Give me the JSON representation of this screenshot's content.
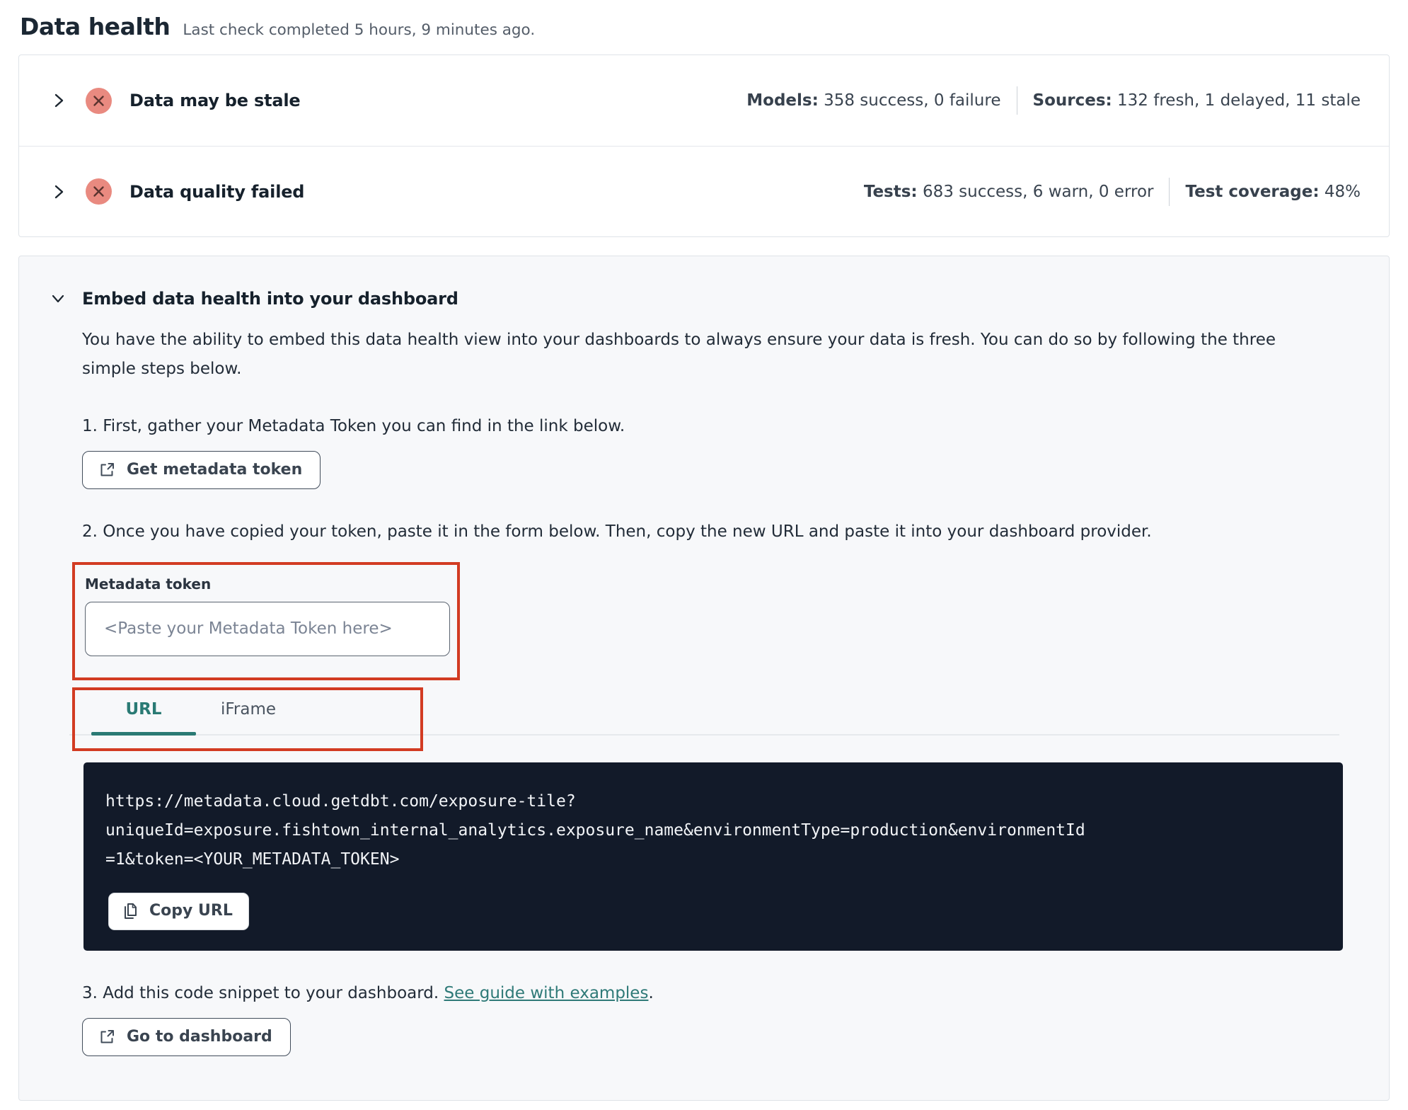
{
  "page": {
    "title": "Data health",
    "subtitle": "Last check completed 5 hours, 9 minutes ago."
  },
  "status_rows": [
    {
      "title": "Data may be stale",
      "status_icon": "error-x-circle",
      "stats": [
        {
          "label": "Models:",
          "value": "358 success, 0 failure"
        },
        {
          "label": "Sources:",
          "value": "132 fresh, 1 delayed, 11 stale"
        }
      ]
    },
    {
      "title": "Data quality failed",
      "status_icon": "error-x-circle",
      "stats": [
        {
          "label": "Tests:",
          "value": "683 success, 6 warn, 0 error"
        },
        {
          "label": "Test coverage:",
          "value": "48%"
        }
      ]
    }
  ],
  "embed": {
    "title": "Embed data health into your dashboard",
    "description": "You have the ability to embed this data health view into your dashboards to always ensure your data is fresh. You can do so by following the three simple steps below.",
    "step1": "1. First, gather your Metadata Token you can find in the link below.",
    "get_token_button": "Get metadata token",
    "step2": "2. Once you have copied your token, paste it in the form below. Then, copy the new URL and paste it into your dashboard provider.",
    "token_field": {
      "label": "Metadata token",
      "placeholder": "<Paste your Metadata Token here>"
    },
    "tabs": [
      {
        "label": "URL",
        "active": true
      },
      {
        "label": "iFrame",
        "active": false
      }
    ],
    "code_lines": [
      "https://metadata.cloud.getdbt.com/exposure-tile?",
      "uniqueId=exposure.fishtown_internal_analytics.exposure_name&environmentType=production&environmentId",
      "=1&token=<YOUR_METADATA_TOKEN>"
    ],
    "copy_button": "Copy URL",
    "step3_prefix": "3. Add this code snippet to your dashboard. ",
    "step3_link": "See guide with examples",
    "step3_suffix": ".",
    "dashboard_button": "Go to dashboard"
  },
  "colors": {
    "accent_teal": "#2a7a74",
    "annotation_red": "#d23b22",
    "error_salmon": "#e98a80",
    "error_x": "#5a332e",
    "code_background": "#121a29"
  }
}
